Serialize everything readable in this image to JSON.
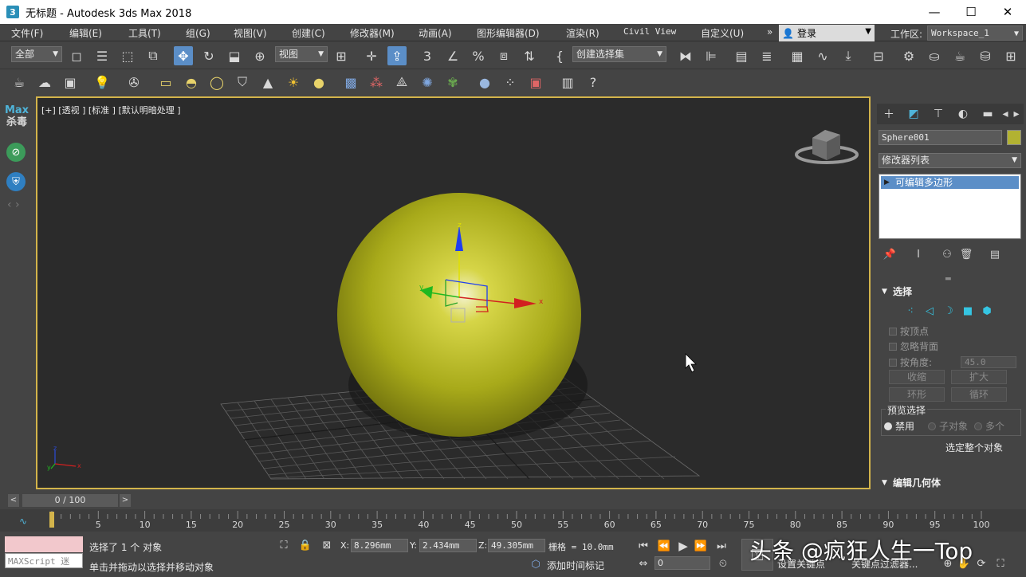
{
  "window": {
    "title": "无标题 - Autodesk 3ds Max 2018",
    "logo_text": "3",
    "minimize": "—",
    "maximize": "☐",
    "close": "✕"
  },
  "menu": {
    "items": [
      "文件(F)",
      "编辑(E)",
      "工具(T)",
      "组(G)",
      "视图(V)",
      "创建(C)",
      "修改器(M)",
      "动画(A)",
      "图形编辑器(D)",
      "渲染(R)",
      "Civil View",
      "自定义(U)"
    ],
    "more": "»",
    "login": "登录",
    "workspace_label": "工作区:",
    "workspace_value": "Workspace_1"
  },
  "toolbar": {
    "selection_filter": "全部",
    "ref_coord": "视图",
    "named_selection": "创建选择集"
  },
  "left_strip": {
    "logo_top": "Max",
    "logo_bottom": "杀毒",
    "nav": "‹ ›"
  },
  "viewport": {
    "label": "[+] [透视 ] [标准 ] [默认明暗处理 ]",
    "object_color": "#b9bb1d",
    "gizmo_x": "x",
    "gizmo_y": "y",
    "gizmo_z": "z"
  },
  "command_panel": {
    "object_name": "Sphere001",
    "object_color": "#b2b232",
    "modifier_list": "修改器列表",
    "stack_item": "可编辑多边形",
    "selection_title": "选择",
    "by_vertex": "按顶点",
    "ignore_backface": "忽略背面",
    "by_angle": "按角度:",
    "angle_value": "45.0",
    "shrink": "收缩",
    "grow": "扩大",
    "ring": "环形",
    "loop": "循环",
    "preview_title": "预览选择",
    "preview_off": "禁用",
    "preview_sub": "子对象",
    "preview_multi": "多个",
    "select_whole": "选定整个对象",
    "edit_geometry_title": "编辑几何体"
  },
  "timeline": {
    "frame_label": "0 / 100",
    "ticks": [
      "5",
      "10",
      "15",
      "20",
      "25",
      "30",
      "35",
      "40",
      "45",
      "50",
      "55",
      "60",
      "65",
      "70",
      "75",
      "80",
      "85",
      "90",
      "95",
      "100"
    ]
  },
  "status": {
    "maxscript_placeholder": "MAXScript 迷",
    "selected_text": "选择了 1 个 对象",
    "hint_text": "单击并拖动以选择并移动对象",
    "x_label": "X:",
    "x_value": "8.296mm",
    "y_label": "Y:",
    "y_value": "2.434mm",
    "z_label": "Z:",
    "z_value": "49.305mm",
    "grid_text": "栅格 = 10.0mm",
    "add_time_tag": "添加时间标记",
    "current_frame": "0",
    "set_key": "设置关键点",
    "key_filter": "关键点过滤器..."
  },
  "watermark": "头条 @疯狂人生一Top"
}
